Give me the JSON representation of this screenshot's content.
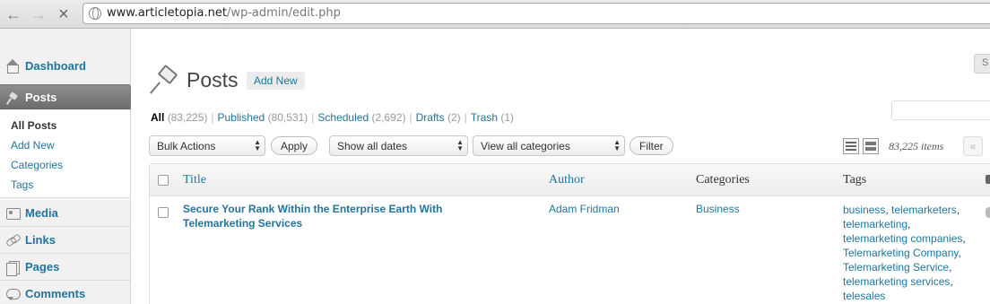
{
  "browser": {
    "url_host": "www.articletopia.net",
    "url_path": "/wp-admin/edit.php"
  },
  "sidebar": {
    "dashboard": "Dashboard",
    "posts": "Posts",
    "submenu": [
      "All Posts",
      "Add New",
      "Categories",
      "Tags"
    ],
    "media": "Media",
    "links": "Links",
    "pages": "Pages",
    "comments": "Comments"
  },
  "header": {
    "title": "Posts",
    "add_new": "Add New",
    "screen_options": "S"
  },
  "filters": {
    "all_label": "All",
    "all_count": "(83,225)",
    "published_label": "Published",
    "published_count": "(80,531)",
    "scheduled_label": "Scheduled",
    "scheduled_count": "(2,692)",
    "drafts_label": "Drafts",
    "drafts_count": "(2)",
    "trash_label": "Trash",
    "trash_count": "(1)",
    "separator": "|"
  },
  "toolbar": {
    "bulk_actions": "Bulk Actions",
    "apply": "Apply",
    "dates": "Show all dates",
    "categories": "View all categories",
    "filter": "Filter",
    "items_count": "83,225 items",
    "first_page": "«"
  },
  "table": {
    "columns": [
      "Title",
      "Author",
      "Categories",
      "Tags"
    ],
    "row": {
      "title_line1": "Secure Your Rank Within the Enterprise Earth With",
      "title_line2": "Telemarketing Services",
      "author": "Adam Fridman",
      "category": "Business",
      "tags": [
        "business",
        "telemarketers",
        "telemarketing",
        "telemarketing companies",
        "Telemarketing Company",
        "Telemarketing Service",
        "telemarketing services",
        "telesales"
      ]
    }
  }
}
